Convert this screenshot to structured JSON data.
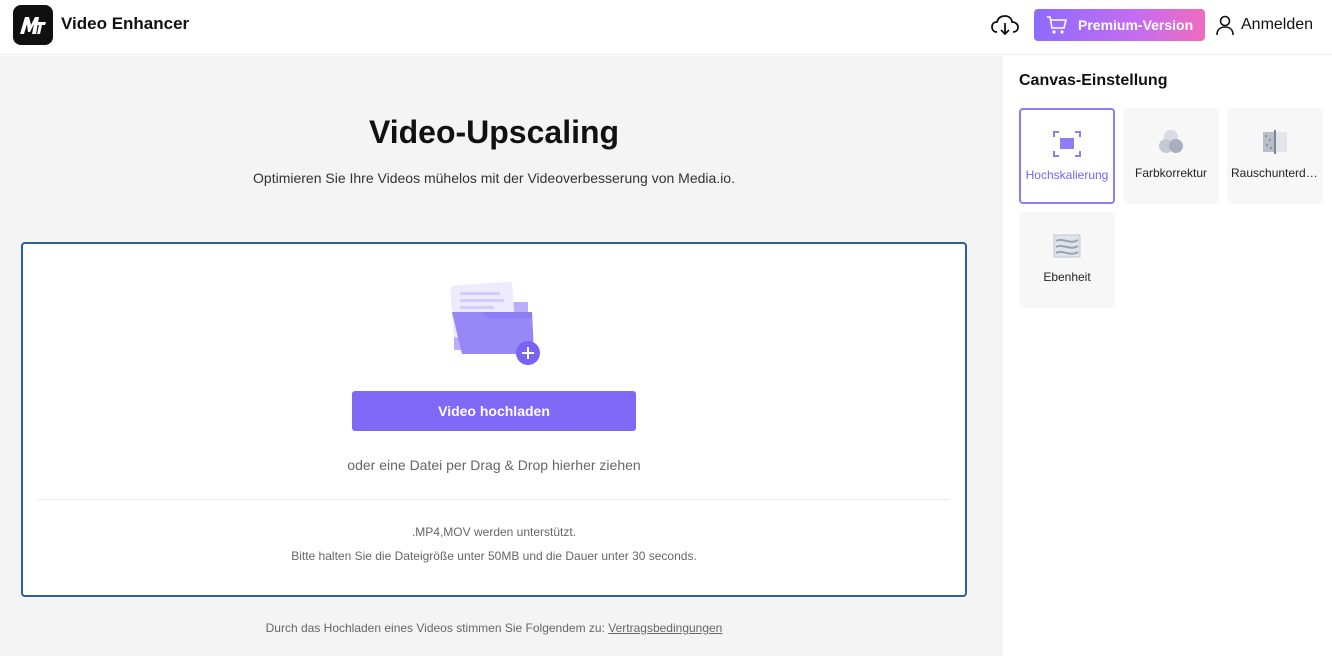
{
  "header": {
    "logo_text": "M",
    "app_title": "Video Enhancer",
    "premium_label": "Premium-Version",
    "login_label": "Anmelden"
  },
  "main": {
    "heading": "Video-Upscaling",
    "subtitle": "Optimieren Sie Ihre Videos mühelos mit der Videoverbesserung von Media.io.",
    "upload_button": "Video hochladen",
    "drag_text": "oder eine Datei per Drag & Drop hierher ziehen",
    "formats_text": ".MP4,MOV werden unterstützt.",
    "limits_text": "Bitte halten Sie die Dateigröße unter 50MB und die Dauer unter 30 seconds.",
    "terms_text": "Durch das Hochladen eines Videos stimmen Sie Folgendem zu:",
    "terms_link": "Vertragsbedingungen"
  },
  "sidebar": {
    "title": "Canvas-Einstellung",
    "options": [
      {
        "label": "Hochskalierung",
        "icon": "upscale-icon",
        "selected": true
      },
      {
        "label": "Farbkorrektur",
        "icon": "color-correction-icon",
        "selected": false
      },
      {
        "label": "Rauschunterdrückung",
        "icon": "noise-reduction-icon",
        "selected": false
      },
      {
        "label": "Ebenheit",
        "icon": "smoothness-icon",
        "selected": false
      }
    ]
  },
  "colors": {
    "accent": "#8169f7",
    "premium_gradient_start": "#8e6bff",
    "premium_gradient_end": "#ef6cc0",
    "dropzone_border": "#2f5f9a",
    "main_bg": "#f4f4f5"
  }
}
